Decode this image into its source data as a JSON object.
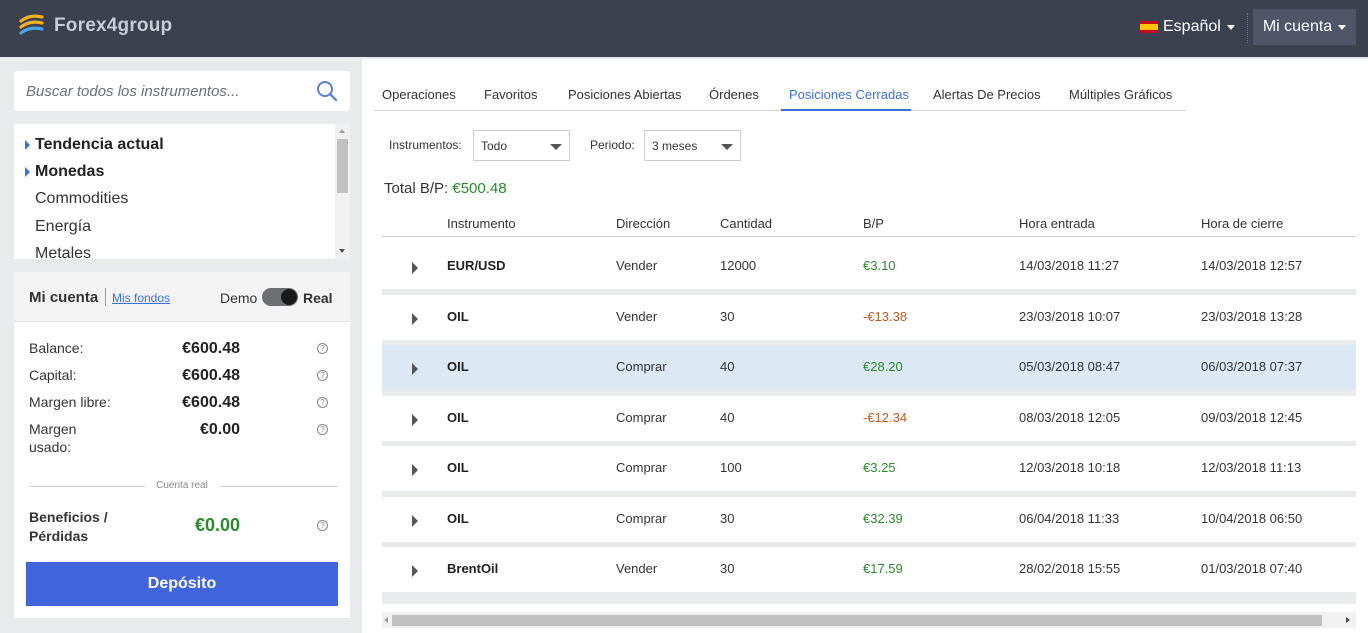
{
  "brand": {
    "name": "Forex4group"
  },
  "header": {
    "language": "Español",
    "account_menu": "Mi cuenta"
  },
  "search": {
    "placeholder": "Buscar todos los instrumentos..."
  },
  "categories": [
    {
      "label": "Tendencia actual",
      "expandable": true
    },
    {
      "label": "Monedas",
      "expandable": true
    },
    {
      "label": "Commodities",
      "expandable": false
    },
    {
      "label": "Energía",
      "expandable": false
    },
    {
      "label": "Metales",
      "expandable": false
    }
  ],
  "account": {
    "title": "Mi cuenta",
    "funds_link": "Mis fondos",
    "demo_label": "Demo",
    "real_label": "Real",
    "stats": [
      {
        "label": "Balance:",
        "value": "€600.48"
      },
      {
        "label": "Capital:",
        "value": "€600.48"
      },
      {
        "label": "Margen libre:",
        "value": "€600.48"
      },
      {
        "label": "Margen usado:",
        "value": "€0.00"
      }
    ],
    "divider": "Cuenta real",
    "pl_label": "Beneficios / Pérdidas",
    "pl_value": "€0.00",
    "deposit": "Depósito"
  },
  "tabs": [
    {
      "label": "Operaciones",
      "active": false
    },
    {
      "label": "Favoritos",
      "active": false
    },
    {
      "label": "Posiciones Abiertas",
      "active": false
    },
    {
      "label": "Órdenes",
      "active": false
    },
    {
      "label": "Posiciones Cerradas",
      "active": true
    },
    {
      "label": "Alertas De Precios",
      "active": false
    },
    {
      "label": "Múltiples Gráficos",
      "active": false
    }
  ],
  "filters": {
    "instruments_label": "Instrumentos:",
    "instruments_value": "Todo",
    "period_label": "Periodo:",
    "period_value": "3 meses"
  },
  "total": {
    "label": "Total B/P:",
    "value": "€500.48"
  },
  "table": {
    "headers": [
      "Instrumento",
      "Dirección",
      "Cantidad",
      "B/P",
      "Hora entrada",
      "Hora de cierre"
    ],
    "rows": [
      {
        "instrument": "EUR/USD",
        "direction": "Vender",
        "quantity": "12000",
        "pl": "€3.10",
        "entry": "14/03/2018 11:27",
        "close": "14/03/2018 12:57",
        "positive": true
      },
      {
        "instrument": "OIL",
        "direction": "Vender",
        "quantity": "30",
        "pl": "-€13.38",
        "entry": "23/03/2018 10:07",
        "close": "23/03/2018 13:28",
        "positive": false
      },
      {
        "instrument": "OIL",
        "direction": "Comprar",
        "quantity": "40",
        "pl": "€28.20",
        "entry": "05/03/2018 08:47",
        "close": "06/03/2018 07:37",
        "positive": true,
        "selected": true
      },
      {
        "instrument": "OIL",
        "direction": "Comprar",
        "quantity": "40",
        "pl": "-€12.34",
        "entry": "08/03/2018 12:05",
        "close": "09/03/2018 12:45",
        "positive": false
      },
      {
        "instrument": "OIL",
        "direction": "Comprar",
        "quantity": "100",
        "pl": "€3.25",
        "entry": "12/03/2018 10:18",
        "close": "12/03/2018 11:13",
        "positive": true
      },
      {
        "instrument": "OIL",
        "direction": "Comprar",
        "quantity": "30",
        "pl": "€32.39",
        "entry": "06/04/2018 11:33",
        "close": "10/04/2018 06:50",
        "positive": true
      },
      {
        "instrument": "BrentOil",
        "direction": "Vender",
        "quantity": "30",
        "pl": "€17.59",
        "entry": "28/02/2018 15:55",
        "close": "01/03/2018 07:40",
        "positive": true
      }
    ]
  },
  "colors": {
    "accent": "#3f64dc",
    "positive": "#2a8a2a",
    "negative": "#c25a1c",
    "topbar": "#3c4150"
  }
}
